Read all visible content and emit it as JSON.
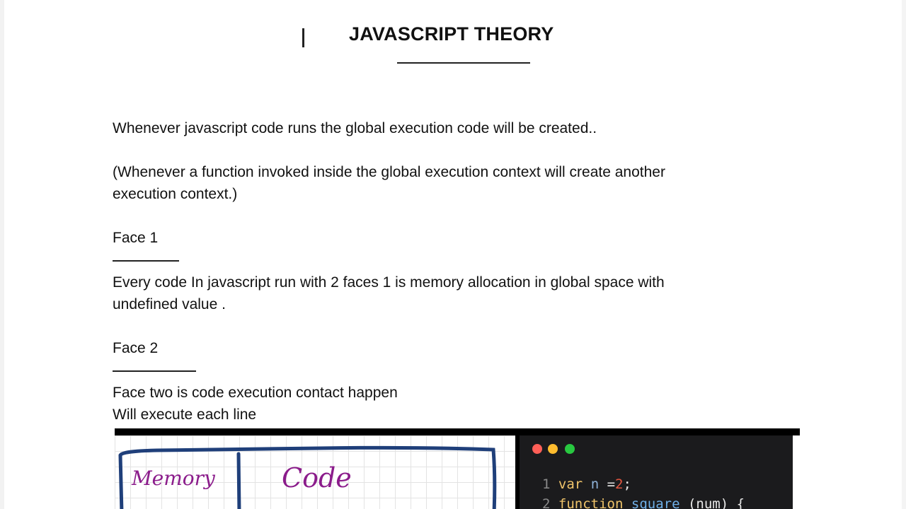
{
  "document": {
    "title": "JAVASCRIPT THEORY",
    "intro": "Whenever javascript code runs the global execution code will be created..",
    "note_line1": "(Whenever a function invoked inside the global execution context will create another",
    "note_line2": "execution context.)",
    "face1_heading": "Face 1",
    "face1_line1": "Every code In javascript run with 2 faces 1 is memory allocation in global space  with",
    "face1_line2": "undefined value .",
    "face2_heading": "Face 2",
    "face2_line1": "Face two is code execution contact happen",
    "face2_line2": "Will execute each line"
  },
  "diagram": {
    "memory_label": "Memory",
    "code_label": "Code"
  },
  "code_window": {
    "colors": {
      "close": "#ff5f57",
      "minimize": "#febc2e",
      "maximize": "#28c840",
      "background": "#1b1b1d"
    },
    "line1": {
      "num": "1",
      "kw": "var",
      "name": "n",
      "op": " =",
      "value": "2",
      "end": ";"
    },
    "line2": {
      "num": "2",
      "kw": "function",
      "name": "square",
      "rest": "(num) {"
    }
  }
}
